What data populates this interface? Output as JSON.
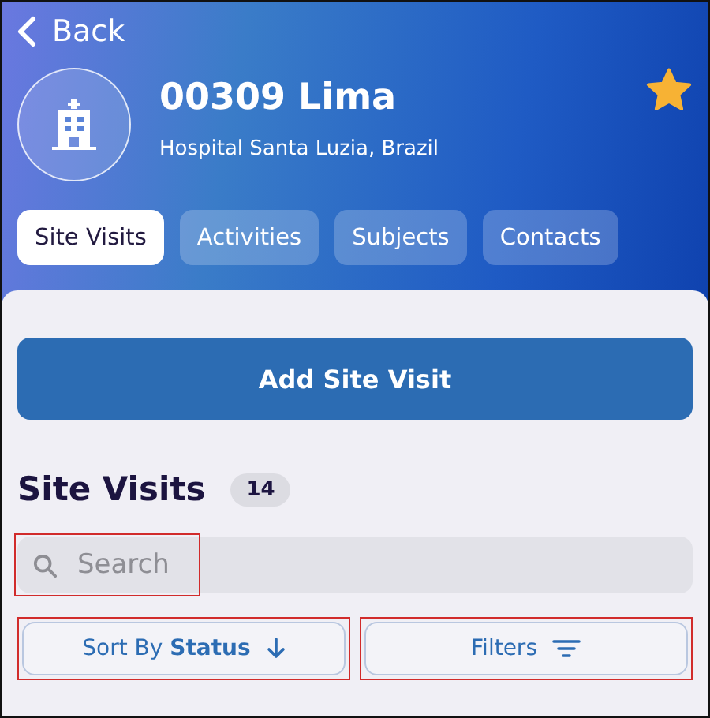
{
  "nav": {
    "back": "Back"
  },
  "site": {
    "title": "00309 Lima",
    "subtitle": "Hospital Santa Luzia, Brazil",
    "favorite": true
  },
  "tabs": [
    {
      "label": "Site Visits",
      "selected": true
    },
    {
      "label": "Activities",
      "selected": false
    },
    {
      "label": "Subjects",
      "selected": false
    },
    {
      "label": "Contacts",
      "selected": false
    }
  ],
  "add_button": "Add Site Visit",
  "section": {
    "title": "Site Visits",
    "count": "14"
  },
  "search": {
    "placeholder": "Search",
    "highlighted": true
  },
  "sort_button": {
    "label": "Sort By **Status**",
    "highlighted": true
  },
  "filters_button": {
    "label": "Filters",
    "highlighted": true
  }
}
